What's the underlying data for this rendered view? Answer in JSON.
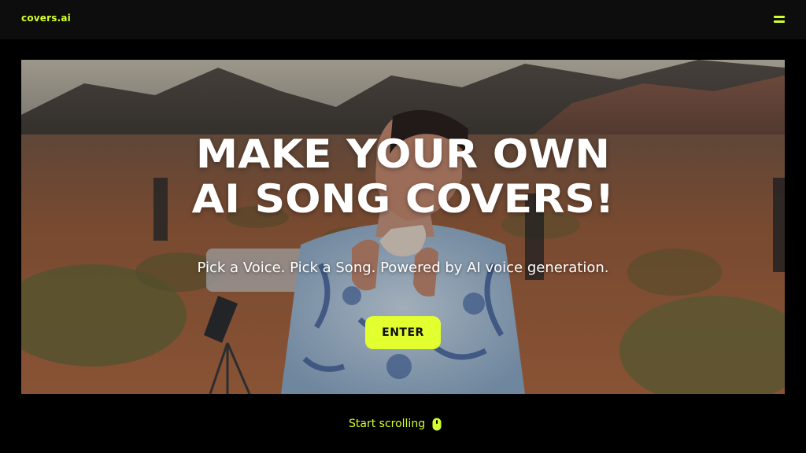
{
  "header": {
    "logo_text": "covers.ai",
    "menu_icon": "hamburger-menu-icon"
  },
  "hero": {
    "title_line1": "MAKE YOUR OWN",
    "title_line2": "AI SONG COVERS!",
    "subtitle": "Pick a Voice. Pick a Song. Powered by AI voice generation.",
    "cta_label": "ENTER"
  },
  "footer": {
    "scroll_hint": "Start scrolling",
    "scroll_icon": "mouse-icon"
  },
  "colors": {
    "accent": "#d4ff2a",
    "button": "#e2ff2f",
    "background": "#000000",
    "header": "#0d0d0d"
  }
}
